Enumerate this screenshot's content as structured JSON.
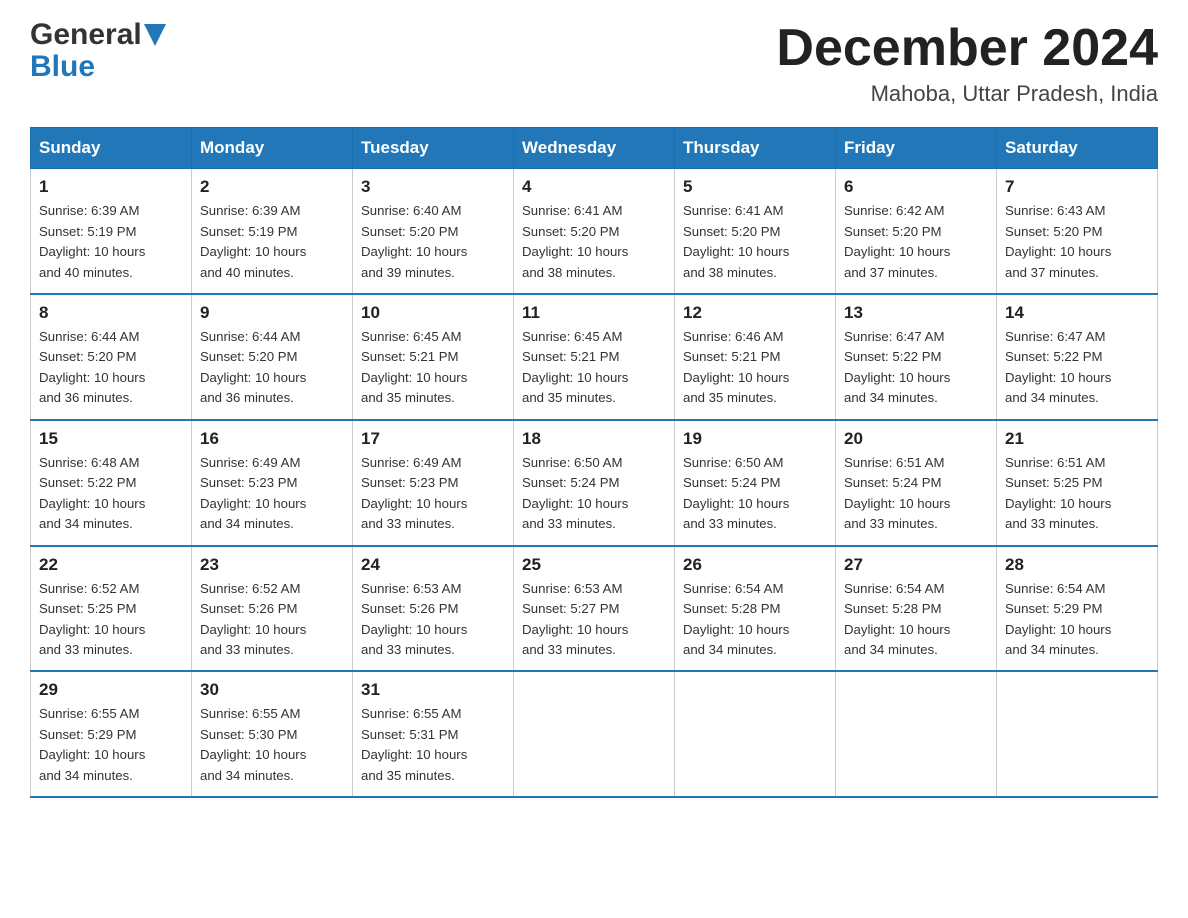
{
  "header": {
    "logo_general": "General",
    "logo_blue": "Blue",
    "month_year": "December 2024",
    "location": "Mahoba, Uttar Pradesh, India"
  },
  "days_of_week": [
    "Sunday",
    "Monday",
    "Tuesday",
    "Wednesday",
    "Thursday",
    "Friday",
    "Saturday"
  ],
  "weeks": [
    [
      {
        "day": "1",
        "sunrise": "6:39 AM",
        "sunset": "5:19 PM",
        "daylight": "10 hours and 40 minutes."
      },
      {
        "day": "2",
        "sunrise": "6:39 AM",
        "sunset": "5:19 PM",
        "daylight": "10 hours and 40 minutes."
      },
      {
        "day": "3",
        "sunrise": "6:40 AM",
        "sunset": "5:20 PM",
        "daylight": "10 hours and 39 minutes."
      },
      {
        "day": "4",
        "sunrise": "6:41 AM",
        "sunset": "5:20 PM",
        "daylight": "10 hours and 38 minutes."
      },
      {
        "day": "5",
        "sunrise": "6:41 AM",
        "sunset": "5:20 PM",
        "daylight": "10 hours and 38 minutes."
      },
      {
        "day": "6",
        "sunrise": "6:42 AM",
        "sunset": "5:20 PM",
        "daylight": "10 hours and 37 minutes."
      },
      {
        "day": "7",
        "sunrise": "6:43 AM",
        "sunset": "5:20 PM",
        "daylight": "10 hours and 37 minutes."
      }
    ],
    [
      {
        "day": "8",
        "sunrise": "6:44 AM",
        "sunset": "5:20 PM",
        "daylight": "10 hours and 36 minutes."
      },
      {
        "day": "9",
        "sunrise": "6:44 AM",
        "sunset": "5:20 PM",
        "daylight": "10 hours and 36 minutes."
      },
      {
        "day": "10",
        "sunrise": "6:45 AM",
        "sunset": "5:21 PM",
        "daylight": "10 hours and 35 minutes."
      },
      {
        "day": "11",
        "sunrise": "6:45 AM",
        "sunset": "5:21 PM",
        "daylight": "10 hours and 35 minutes."
      },
      {
        "day": "12",
        "sunrise": "6:46 AM",
        "sunset": "5:21 PM",
        "daylight": "10 hours and 35 minutes."
      },
      {
        "day": "13",
        "sunrise": "6:47 AM",
        "sunset": "5:22 PM",
        "daylight": "10 hours and 34 minutes."
      },
      {
        "day": "14",
        "sunrise": "6:47 AM",
        "sunset": "5:22 PM",
        "daylight": "10 hours and 34 minutes."
      }
    ],
    [
      {
        "day": "15",
        "sunrise": "6:48 AM",
        "sunset": "5:22 PM",
        "daylight": "10 hours and 34 minutes."
      },
      {
        "day": "16",
        "sunrise": "6:49 AM",
        "sunset": "5:23 PM",
        "daylight": "10 hours and 34 minutes."
      },
      {
        "day": "17",
        "sunrise": "6:49 AM",
        "sunset": "5:23 PM",
        "daylight": "10 hours and 33 minutes."
      },
      {
        "day": "18",
        "sunrise": "6:50 AM",
        "sunset": "5:24 PM",
        "daylight": "10 hours and 33 minutes."
      },
      {
        "day": "19",
        "sunrise": "6:50 AM",
        "sunset": "5:24 PM",
        "daylight": "10 hours and 33 minutes."
      },
      {
        "day": "20",
        "sunrise": "6:51 AM",
        "sunset": "5:24 PM",
        "daylight": "10 hours and 33 minutes."
      },
      {
        "day": "21",
        "sunrise": "6:51 AM",
        "sunset": "5:25 PM",
        "daylight": "10 hours and 33 minutes."
      }
    ],
    [
      {
        "day": "22",
        "sunrise": "6:52 AM",
        "sunset": "5:25 PM",
        "daylight": "10 hours and 33 minutes."
      },
      {
        "day": "23",
        "sunrise": "6:52 AM",
        "sunset": "5:26 PM",
        "daylight": "10 hours and 33 minutes."
      },
      {
        "day": "24",
        "sunrise": "6:53 AM",
        "sunset": "5:26 PM",
        "daylight": "10 hours and 33 minutes."
      },
      {
        "day": "25",
        "sunrise": "6:53 AM",
        "sunset": "5:27 PM",
        "daylight": "10 hours and 33 minutes."
      },
      {
        "day": "26",
        "sunrise": "6:54 AM",
        "sunset": "5:28 PM",
        "daylight": "10 hours and 34 minutes."
      },
      {
        "day": "27",
        "sunrise": "6:54 AM",
        "sunset": "5:28 PM",
        "daylight": "10 hours and 34 minutes."
      },
      {
        "day": "28",
        "sunrise": "6:54 AM",
        "sunset": "5:29 PM",
        "daylight": "10 hours and 34 minutes."
      }
    ],
    [
      {
        "day": "29",
        "sunrise": "6:55 AM",
        "sunset": "5:29 PM",
        "daylight": "10 hours and 34 minutes."
      },
      {
        "day": "30",
        "sunrise": "6:55 AM",
        "sunset": "5:30 PM",
        "daylight": "10 hours and 34 minutes."
      },
      {
        "day": "31",
        "sunrise": "6:55 AM",
        "sunset": "5:31 PM",
        "daylight": "10 hours and 35 minutes."
      },
      null,
      null,
      null,
      null
    ]
  ],
  "labels": {
    "sunrise": "Sunrise:",
    "sunset": "Sunset:",
    "daylight": "Daylight:"
  }
}
